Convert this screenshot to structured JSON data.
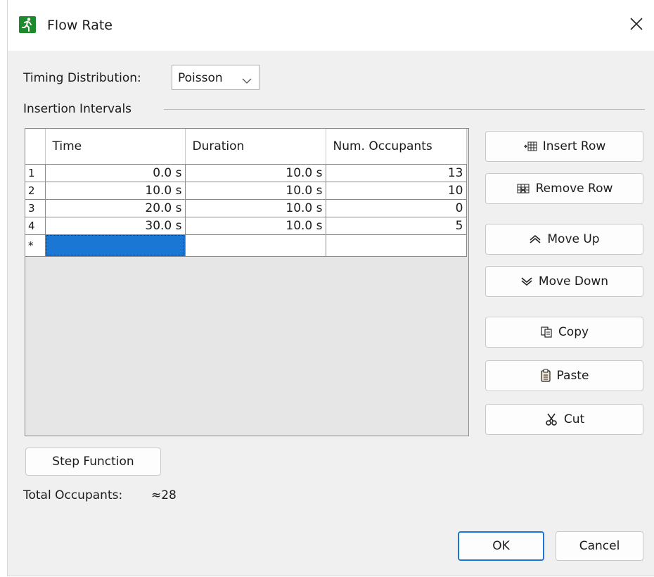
{
  "window": {
    "title": "Flow Rate"
  },
  "timing": {
    "label": "Timing Distribution:",
    "value": "Poisson"
  },
  "section": {
    "title": "Insertion Intervals"
  },
  "table": {
    "columns": [
      "Time",
      "Duration",
      "Num. Occupants"
    ],
    "rows": [
      {
        "num": "1",
        "time": "0.0 s",
        "duration": "10.0 s",
        "occupants": "13"
      },
      {
        "num": "2",
        "time": "10.0 s",
        "duration": "10.0 s",
        "occupants": "10"
      },
      {
        "num": "3",
        "time": "20.0 s",
        "duration": "10.0 s",
        "occupants": "0"
      },
      {
        "num": "4",
        "time": "30.0 s",
        "duration": "10.0 s",
        "occupants": "5"
      }
    ],
    "new_row_marker": "*"
  },
  "side_buttons": {
    "insert_row": "Insert Row",
    "remove_row": "Remove Row",
    "move_up": "Move Up",
    "move_down": "Move Down",
    "copy": "Copy",
    "paste": "Paste",
    "cut": "Cut"
  },
  "step_function": "Step Function",
  "total": {
    "label": "Total Occupants:",
    "value": "≈28"
  },
  "footer": {
    "ok": "OK",
    "cancel": "Cancel"
  },
  "colors": {
    "accent": "#1a78d4",
    "app_icon": "#1d8a2e"
  }
}
